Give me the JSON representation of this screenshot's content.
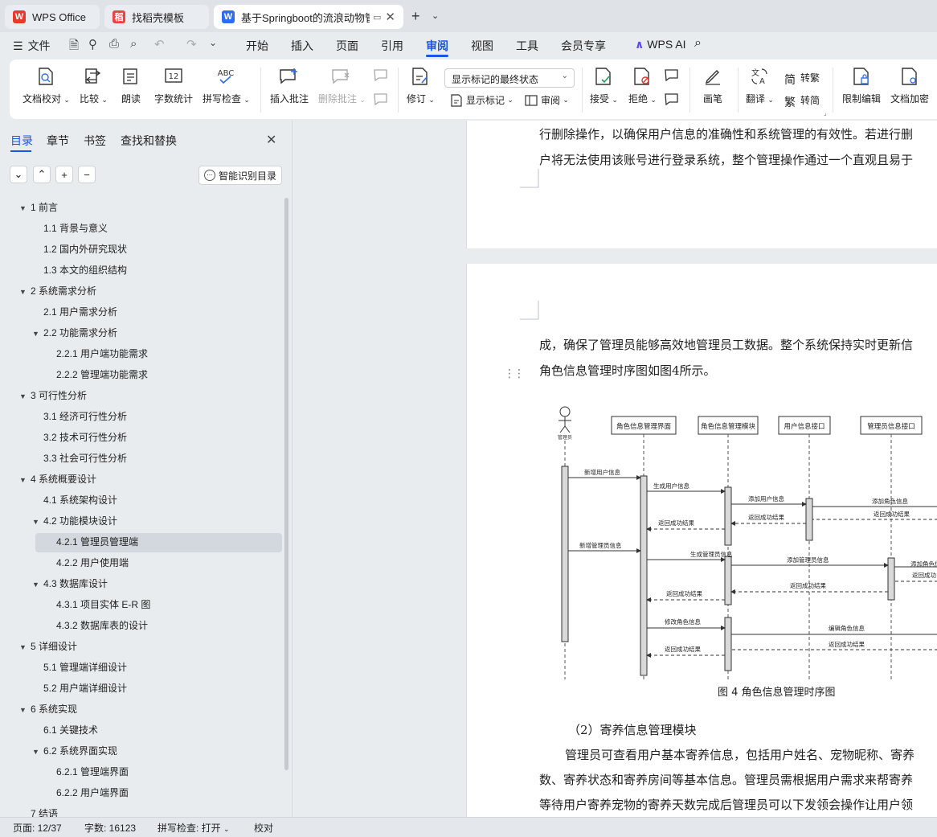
{
  "tabs": [
    {
      "label": "WPS Office",
      "icon": "wps-logo-icon"
    },
    {
      "label": "找稻壳模板",
      "icon": "docer-icon"
    },
    {
      "label": "基于Springboot的流浪动物管",
      "icon": "word-doc-icon"
    }
  ],
  "menu": {
    "file": "文件",
    "items": [
      "开始",
      "插入",
      "页面",
      "引用",
      "审阅",
      "视图",
      "工具",
      "会员专享"
    ],
    "active": "审阅",
    "wps_ai": "WPS AI"
  },
  "ribbon": {
    "doc_check": "文档校对",
    "compare": "比较",
    "read_aloud": "朗读",
    "word_count": "字数统计",
    "word_count_icon_text": "12",
    "spell_check": "拼写检查",
    "spell_icon_text": "ABC",
    "insert_comment": "插入批注",
    "delete_comment": "删除批注",
    "track_changes": "修订",
    "display_select": "显示标记的最终状态",
    "show_markup": "显示标记",
    "review": "审阅",
    "accept": "接受",
    "reject": "拒绝",
    "pen": "画笔",
    "translate": "翻译",
    "to_traditional": "转繁",
    "to_simplified": "转简",
    "restrict_edit": "限制编辑",
    "encrypt": "文档加密"
  },
  "sidebar": {
    "tabs": [
      "目录",
      "章节",
      "书签",
      "查找和替换"
    ],
    "active_tab": "目录",
    "smart_toc": "智能识别目录",
    "toc": [
      {
        "label": "1 前言",
        "level": 1,
        "expanded": true
      },
      {
        "label": "1.1 背景与意义",
        "level": 2
      },
      {
        "label": "1.2 国内外研究现状",
        "level": 2
      },
      {
        "label": "1.3 本文的组织结构",
        "level": 2
      },
      {
        "label": "2 系统需求分析",
        "level": 1,
        "expanded": true
      },
      {
        "label": "2.1 用户需求分析",
        "level": 2
      },
      {
        "label": "2.2 功能需求分析",
        "level": 2,
        "expanded": true
      },
      {
        "label": "2.2.1 用户端功能需求",
        "level": 3
      },
      {
        "label": "2.2.2 管理端功能需求",
        "level": 3
      },
      {
        "label": "3 可行性分析",
        "level": 1,
        "expanded": true
      },
      {
        "label": "3.1 经济可行性分析",
        "level": 2
      },
      {
        "label": "3.2 技术可行性分析",
        "level": 2
      },
      {
        "label": "3.3 社会可行性分析",
        "level": 2
      },
      {
        "label": "4 系统概要设计",
        "level": 1,
        "expanded": true
      },
      {
        "label": "4.1 系统架构设计",
        "level": 2
      },
      {
        "label": "4.2 功能模块设计",
        "level": 2,
        "expanded": true
      },
      {
        "label": "4.2.1 管理员管理端",
        "level": 3,
        "selected": true
      },
      {
        "label": "4.2.2 用户使用端",
        "level": 3
      },
      {
        "label": "4.3 数据库设计",
        "level": 2,
        "expanded": true
      },
      {
        "label": "4.3.1 项目实体 E-R 图",
        "level": 3
      },
      {
        "label": "4.3.2 数据库表的设计",
        "level": 3
      },
      {
        "label": "5 详细设计",
        "level": 1,
        "expanded": true
      },
      {
        "label": "5.1 管理端详细设计",
        "level": 2
      },
      {
        "label": "5.2 用户端详细设计",
        "level": 2
      },
      {
        "label": "6  系统实现",
        "level": 1,
        "expanded": true
      },
      {
        "label": "6.1 关键技术",
        "level": 2
      },
      {
        "label": "6.2 系统界面实现",
        "level": 2,
        "expanded": true
      },
      {
        "label": "6.2.1 管理端界面",
        "level": 3
      },
      {
        "label": "6.2.2 用户端界面",
        "level": 3
      },
      {
        "label": "7 结语",
        "level": 1
      }
    ]
  },
  "document": {
    "page1_lines": [
      "行删除操作，以确保用户信息的准确性和系统管理的有效性。若进行删",
      "户将无法使用该账号进行登录系统，整个管理操作通过一个直观且易于"
    ],
    "page2_lines": [
      "成，确保了管理员能够高效地管理员工数据。整个系统保持实时更新信",
      "角色信息管理时序图如图4所示。"
    ],
    "figure": {
      "actor": "管理员",
      "lifelines": [
        "角色信息管理界面",
        "角色信息管理模块",
        "用户信息接口",
        "管理员信息接口"
      ],
      "messages": [
        "新增用户信息",
        "生成用户信息",
        "添加用户信息",
        "添加角色信息",
        "返回成功结果",
        "返回成功结果",
        "返回成功结果",
        "新增管理员信息",
        "生成管理员信息",
        "添加管理员信息",
        "添加角色信",
        "返回成功",
        "返回成功结果",
        "返回成功结果",
        "修改角色信息",
        "编辑角色信息",
        "返回成功结果",
        "返回成功结果"
      ],
      "caption": "图 4  角色信息管理时序图"
    },
    "subheading": "（2）寄养信息管理模块",
    "para_lines": [
      "管理员可查看用户基本寄养信息，包括用户姓名、宠物昵称、寄养",
      "数、寄养状态和寄养房间等基本信息。管理员需根据用户需求来帮寄养",
      "等待用户寄养宠物的寄养天数完成后管理员可以下发领会操作让用户领"
    ]
  },
  "status": {
    "page": "页面: 12/37",
    "words": "字数: 16123",
    "spell": "拼写检查: 打开",
    "proof": "校对"
  }
}
